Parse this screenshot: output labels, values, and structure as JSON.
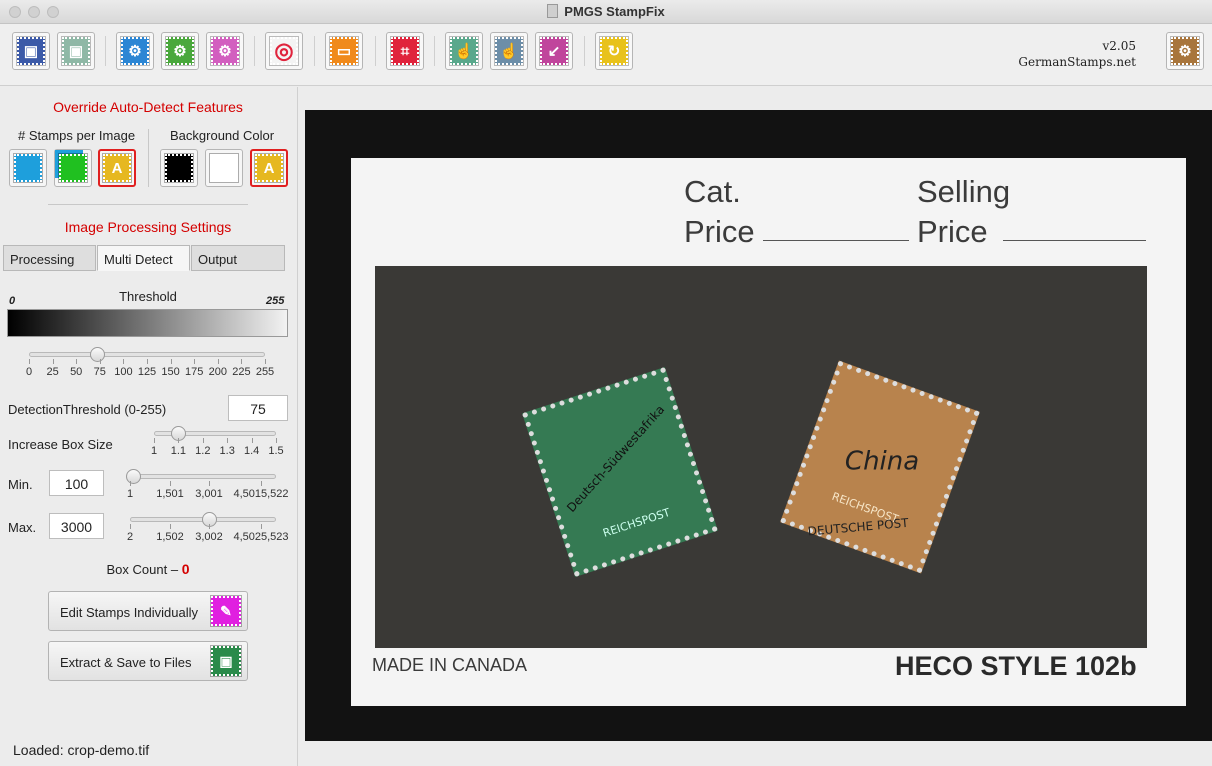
{
  "window": {
    "title": "PMGS StampFix"
  },
  "toolbar": {
    "buttons": [
      {
        "icon": "save-icon",
        "color": "#3c5aa8",
        "glyph": "▣"
      },
      {
        "icon": "save-disabled-icon",
        "color": "#8fb8a6",
        "glyph": "▣"
      },
      {
        "icon": "gear-upload-icon",
        "color": "#2c86d4",
        "glyph": "⚙"
      },
      {
        "icon": "gear-download-icon",
        "color": "#4aa83c",
        "glyph": "⚙"
      },
      {
        "icon": "gear-reset-icon",
        "color": "#d25fbf",
        "glyph": "⚙"
      },
      {
        "icon": "target-icon",
        "color": "#f4f4f4",
        "glyph": "◎"
      },
      {
        "icon": "monitor-icon",
        "color": "#f08a1c",
        "glyph": "▭"
      },
      {
        "icon": "crop-icon",
        "color": "#e0233c",
        "glyph": "⌗"
      },
      {
        "icon": "hand-select-icon",
        "color": "#5aa88c",
        "glyph": "☝"
      },
      {
        "icon": "hand-add-icon",
        "color": "#6d8ea8",
        "glyph": "☝"
      },
      {
        "icon": "export-icon",
        "color": "#c0459c",
        "glyph": "↙"
      },
      {
        "icon": "refresh-icon",
        "color": "#e8c21c",
        "glyph": "↻"
      },
      {
        "icon": "settings-icon",
        "color": "#a8753c",
        "glyph": "⚙"
      }
    ],
    "version": "v2.05",
    "site": "GermanStamps.net"
  },
  "override": {
    "heading": "Override Auto-Detect Features",
    "stamps_label": "# Stamps per Image",
    "bg_label": "Background Color",
    "stamp_buttons": [
      {
        "icon": "single-stamp-icon",
        "color": "#1e9fdc"
      },
      {
        "icon": "multi-stamp-icon",
        "color": "#20c020"
      },
      {
        "icon": "auto-stamp-icon",
        "color": "#e6b820",
        "glyph": "A"
      }
    ],
    "bg_buttons": [
      {
        "icon": "black-bg-icon",
        "color": "#000000"
      },
      {
        "icon": "white-bg-icon",
        "color": "#ffffff"
      },
      {
        "icon": "auto-bg-icon",
        "color": "#e6b820",
        "glyph": "A"
      }
    ]
  },
  "processing": {
    "heading": "Image Processing Settings",
    "tabs": [
      "Processing",
      "Multi Detect",
      "Output"
    ],
    "active_tab": "Multi Detect",
    "threshold": {
      "title": "Threshold",
      "min_label": "0",
      "max_label": "255",
      "ticks": [
        "0",
        "25",
        "50",
        "75",
        "100",
        "125",
        "150",
        "175",
        "200",
        "225",
        "255"
      ],
      "value_fraction": 0.29
    },
    "detection_label": "DetectionThreshold (0-255)",
    "detection_value": "75",
    "box_size_label": "Increase Box Size",
    "box_size_ticks": [
      "1",
      "1.1",
      "1.2",
      "1.3",
      "1.4",
      "1.5"
    ],
    "box_size_fraction": 0.2,
    "min_label": "Min.",
    "min_value": "100",
    "min_ticks": [
      "1",
      "1,501",
      "3,001",
      "4,5015,522"
    ],
    "min_fraction": 0.02,
    "max_label": "Max.",
    "max_value": "3000",
    "max_ticks": [
      "2",
      "1,502",
      "3,002",
      "4,5025,523"
    ],
    "max_fraction": 0.54,
    "box_count_label": "Box Count –",
    "box_count_value": "0",
    "edit_button": "Edit Stamps Individually",
    "extract_button": "Extract & Save to Files"
  },
  "status": {
    "text": "Loaded:  crop-demo.tif"
  },
  "image": {
    "cat": "Cat.",
    "price1": "Price",
    "selling": "Selling",
    "price2": "Price",
    "made_in": "MADE IN CANADA",
    "style": "HECO STYLE 102b",
    "stamp1_text": "REICHSPOST",
    "stamp1_overprint": "Deutsch-Südwestafrika",
    "stamp2_text": "REICHSPOST",
    "stamp2_overprint": "China",
    "stamp2_postmark": "DEUTSCHE POST"
  }
}
